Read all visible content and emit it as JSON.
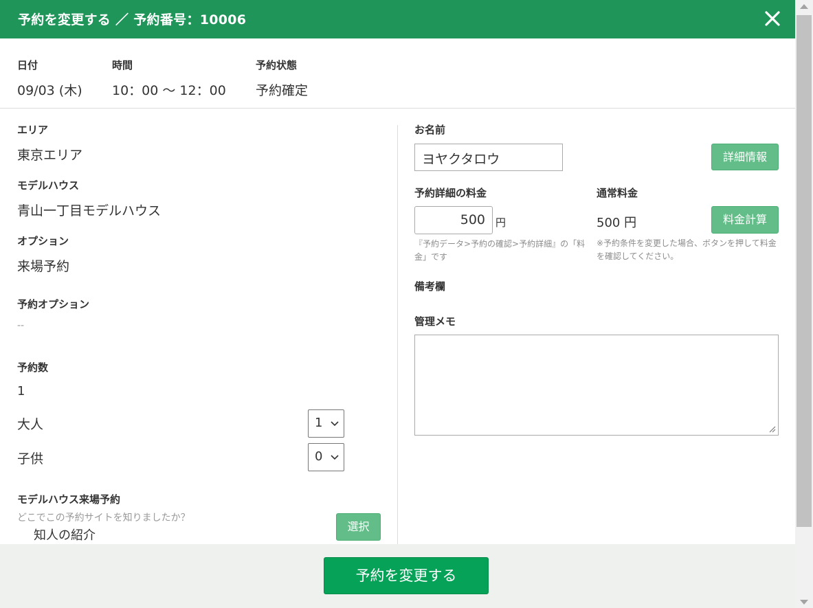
{
  "header": {
    "title": "予約を変更する ／ 予約番号：10006",
    "close_icon": "close-icon"
  },
  "summary": {
    "date_label": "日付",
    "date_value": "09/03 (木)",
    "time_label": "時間",
    "time_value": "10：00 ～ 12：00",
    "status_label": "予約状態",
    "status_value": "予約確定"
  },
  "left": {
    "area_label": "エリア",
    "area_value": "東京エリア",
    "model_house_label": "モデルハウス",
    "model_house_value": "青山一丁目モデルハウス",
    "option_label": "オプション",
    "option_value": "来場予約",
    "reservation_option_label": "予約オプション",
    "reservation_option_value": "--",
    "count_label": "予約数",
    "count_value": "1",
    "adult_label": "大人",
    "adult_selected": "1",
    "child_label": "子供",
    "child_selected": "0",
    "visit_label": "モデルハウス来場予約",
    "question": "どこでこの予約サイトを知りましたか？",
    "answer": "知人の紹介",
    "select_button": "選択"
  },
  "right": {
    "name_label": "お名前",
    "name_value": "ヨヤクタロウ",
    "detail_button": "詳細情報",
    "detail_price_label": "予約詳細の料金",
    "detail_price_value": "500",
    "yen": "円",
    "detail_price_note": "『予約データ>予約の確認>予約詳細』の「料金」です",
    "normal_price_label": "通常料金",
    "normal_price_value": "500 円",
    "calc_button": "料金計算",
    "calc_note": "※予約条件を変更した場合、ボタンを押して料金を確認してください。",
    "remarks_label": "備考欄",
    "memo_label": "管理メモ",
    "memo_value": ""
  },
  "footer": {
    "submit_label": "予約を変更する"
  },
  "colors": {
    "header_bg": "#20955a",
    "primary_button": "#06a257",
    "secondary_button": "#62bd88"
  }
}
